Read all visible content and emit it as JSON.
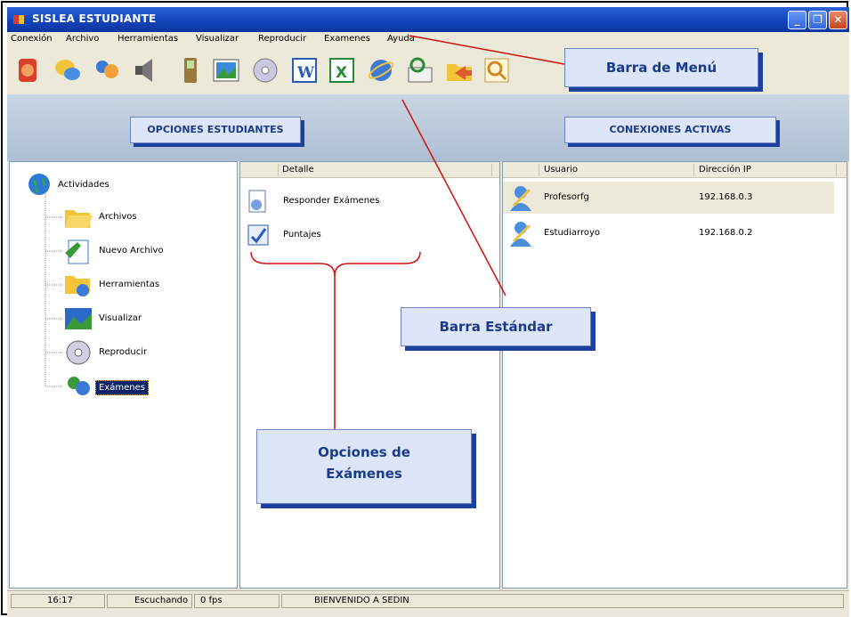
{
  "window": {
    "title": "SISLEA ESTUDIANTE",
    "controls": [
      "_",
      "❐",
      "✕"
    ]
  },
  "menu": [
    "Conexión",
    "Archivo",
    "Herramientas",
    "Visualizar",
    "Reproducir",
    "Examenes",
    "Ayuda"
  ],
  "toolbar_icons": [
    "connect-icon",
    "chat-icon",
    "users-icon",
    "speaker-icon",
    "phone-icon",
    "image-icon",
    "cd-icon",
    "word-icon",
    "excel-icon",
    "ie-icon",
    "email-icon",
    "folder-send-icon",
    "search-icon"
  ],
  "sections": {
    "left": "OPCIONES ESTUDIANTES",
    "right": "CONEXIONES ACTIVAS"
  },
  "tree": {
    "root": "Actividades",
    "items": [
      "Archivos",
      "Nuevo Archivo",
      "Herramientas",
      "Visualizar",
      "Reproducir",
      "Exámenes"
    ]
  },
  "detail": {
    "header": "Detalle",
    "items": [
      "Responder Exámenes",
      "Puntajes"
    ]
  },
  "connections": {
    "headers": [
      "Usuario",
      "Dirección IP"
    ],
    "rows": [
      {
        "user": "Profesorfg",
        "ip": "192.168.0.3"
      },
      {
        "user": "Estudiarroyo",
        "ip": "192.168.0.2"
      }
    ]
  },
  "status": {
    "time": "16:17",
    "state": "Escuchando",
    "fps": "0 fps",
    "message": "BIENVENIDO A SEDIN"
  },
  "callouts": {
    "menu": "Barra de Menú",
    "standard": "Barra Estándar",
    "exams_line1": "Opciones de",
    "exams_line2": "Exámenes"
  },
  "colors": {
    "callout_bg": "#dde6f8",
    "callout_text": "#1a3a8a",
    "arrow": "#d01010",
    "titlebar": "#1242b8"
  }
}
